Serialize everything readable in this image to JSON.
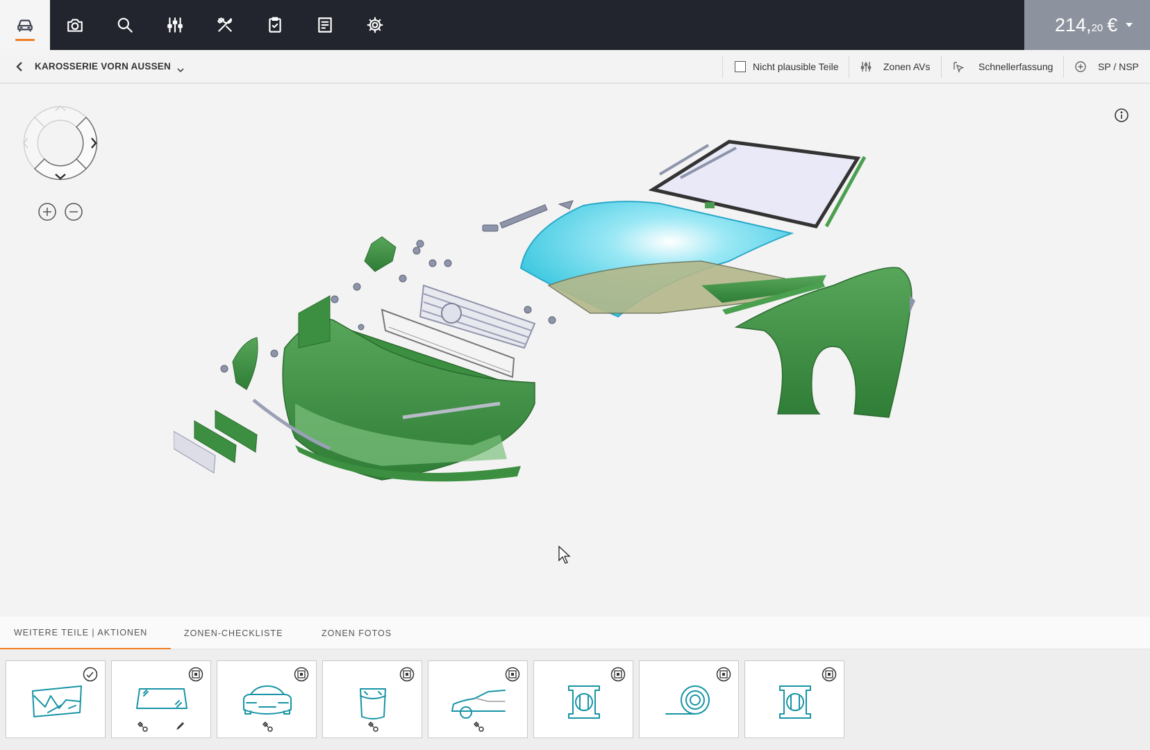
{
  "topbar": {
    "nav": [
      {
        "name": "car-icon",
        "active": true
      },
      {
        "name": "camera-icon",
        "active": false
      },
      {
        "name": "search-icon",
        "active": false
      },
      {
        "name": "sliders-icon",
        "active": false
      },
      {
        "name": "tools-icon",
        "active": false
      },
      {
        "name": "clipboard-check-icon",
        "active": false
      },
      {
        "name": "receipt-icon",
        "active": false
      },
      {
        "name": "gear-icon",
        "active": false
      }
    ],
    "price": {
      "integer": "214,",
      "cents": "20",
      "currency": "€"
    },
    "accent_color": "#f07c1e"
  },
  "subbar": {
    "zone_title": "KAROSSERIE VORN AUSSEN",
    "implausible_label": "Nicht plausible Teile",
    "implausible_checked": false,
    "zones_av_label": "Zonen AVs",
    "quick_capture_label": "Schnellerfassung",
    "sp_nsp_label": "SP / NSP"
  },
  "tabs": [
    {
      "label": "WEITERE TEILE | AKTIONEN",
      "active": true
    },
    {
      "label": "ZONEN-CHECKLISTE",
      "active": false
    },
    {
      "label": "ZONEN FOTOS",
      "active": false
    }
  ],
  "cards": [
    {
      "icon": "damage-map-icon",
      "badge": "checkmark-badge-icon"
    },
    {
      "icon": "windshield-repair-icon",
      "badge": "fast-capture-badge-icon"
    },
    {
      "icon": "car-front-icon",
      "badge": "fast-capture-badge-icon"
    },
    {
      "icon": "paint-bucket-icon",
      "badge": "fast-capture-badge-icon"
    },
    {
      "icon": "car-side-icon",
      "badge": "fast-capture-badge-icon"
    },
    {
      "icon": "measurement-frame-icon",
      "badge": "fast-capture-badge-icon"
    },
    {
      "icon": "roll-icon",
      "badge": "fast-capture-badge-icon"
    },
    {
      "icon": "measurement-frame-icon",
      "badge": "fast-capture-badge-icon"
    }
  ]
}
